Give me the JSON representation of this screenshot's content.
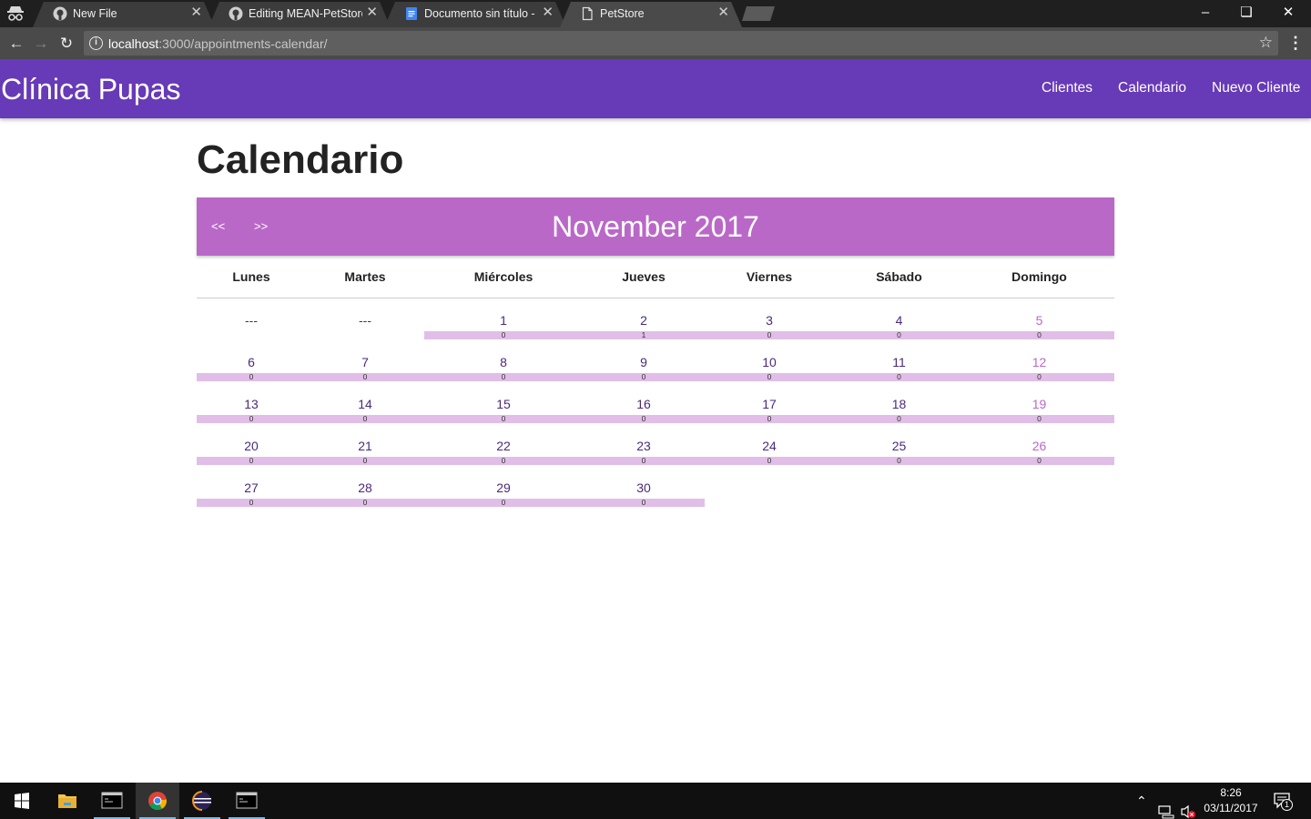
{
  "browser": {
    "tabs": [
      {
        "title": "New File",
        "icon": "github-icon"
      },
      {
        "title": "Editing MEAN-PetStore/",
        "icon": "github-icon"
      },
      {
        "title": "Documento sin título - D",
        "icon": "google-docs-icon"
      },
      {
        "title": "PetStore",
        "icon": "page-icon"
      }
    ],
    "url_host": "localhost",
    "url_rest": ":3000/appointments-calendar/"
  },
  "navbar": {
    "brand": "Clínica Pupas",
    "links": [
      "Clientes",
      "Calendario",
      "Nuevo Cliente"
    ],
    "color": "#673ab7"
  },
  "page": {
    "title": "Calendario"
  },
  "calendar": {
    "prev_label": "<<",
    "next_label": ">>",
    "month_label": "November 2017",
    "header_color": "#ba68c8",
    "bar_color": "#e1bee7",
    "weekdays": [
      "Lunes",
      "Martes",
      "Miércoles",
      "Jueves",
      "Viernes",
      "Sábado",
      "Domingo"
    ],
    "leading_empty": [
      "---",
      "---"
    ],
    "days": [
      {
        "n": "1",
        "c": "0"
      },
      {
        "n": "2",
        "c": "1"
      },
      {
        "n": "3",
        "c": "0"
      },
      {
        "n": "4",
        "c": "0"
      },
      {
        "n": "5",
        "c": "0"
      },
      {
        "n": "6",
        "c": "0"
      },
      {
        "n": "7",
        "c": "0"
      },
      {
        "n": "8",
        "c": "0"
      },
      {
        "n": "9",
        "c": "0"
      },
      {
        "n": "10",
        "c": "0"
      },
      {
        "n": "11",
        "c": "0"
      },
      {
        "n": "12",
        "c": "0"
      },
      {
        "n": "13",
        "c": "0"
      },
      {
        "n": "14",
        "c": "0"
      },
      {
        "n": "15",
        "c": "0"
      },
      {
        "n": "16",
        "c": "0"
      },
      {
        "n": "17",
        "c": "0"
      },
      {
        "n": "18",
        "c": "0"
      },
      {
        "n": "19",
        "c": "0"
      },
      {
        "n": "20",
        "c": "0"
      },
      {
        "n": "21",
        "c": "0"
      },
      {
        "n": "22",
        "c": "0"
      },
      {
        "n": "23",
        "c": "0"
      },
      {
        "n": "24",
        "c": "0"
      },
      {
        "n": "25",
        "c": "0"
      },
      {
        "n": "26",
        "c": "0"
      },
      {
        "n": "27",
        "c": "0"
      },
      {
        "n": "28",
        "c": "0"
      },
      {
        "n": "29",
        "c": "0"
      },
      {
        "n": "30",
        "c": "0"
      }
    ]
  },
  "taskbar": {
    "time": "8:26",
    "date": "03/11/2017",
    "notifications": "1"
  }
}
